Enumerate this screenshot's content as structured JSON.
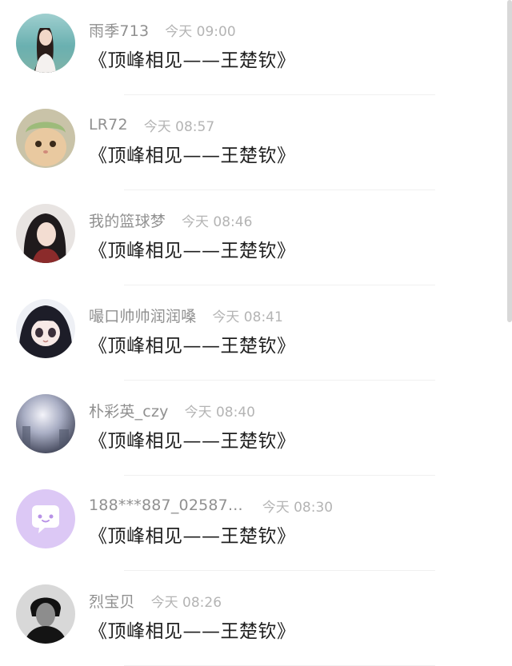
{
  "comments": [
    {
      "name": "雨季713",
      "time": "今天 09:00",
      "text": "《顶峰相见——王楚钦》",
      "avatar_icon": "girl-photo-avatar"
    },
    {
      "name": "LR72",
      "time": "今天 08:57",
      "text": "《顶峰相见——王楚钦》",
      "avatar_icon": "cat-avatar"
    },
    {
      "name": "我的篮球梦",
      "time": "今天 08:46",
      "text": "《顶峰相见——王楚钦》",
      "avatar_icon": "anime-portrait-avatar"
    },
    {
      "name": "嘬口帅帅润润嗓",
      "time": "今天 08:41",
      "text": "《顶峰相见——王楚钦》",
      "avatar_icon": "anime-girl-avatar"
    },
    {
      "name": "朴彩英_czy",
      "time": "今天 08:40",
      "text": "《顶峰相见——王楚钦》",
      "avatar_icon": "blurry-photo-avatar"
    },
    {
      "name": "188***887_02587...",
      "time": "今天 08:30",
      "text": "《顶峰相见——王楚钦》",
      "avatar_icon": "default-chat-bubble-avatar"
    },
    {
      "name": "烈宝贝",
      "time": "今天 08:26",
      "text": "《顶峰相见——王楚钦》",
      "avatar_icon": "bw-portrait-avatar"
    }
  ],
  "colors": {
    "name": "#909090",
    "time": "#b4b4b4",
    "text": "#1f1f1f",
    "default_avatar_bg": "#dcc8f5"
  }
}
